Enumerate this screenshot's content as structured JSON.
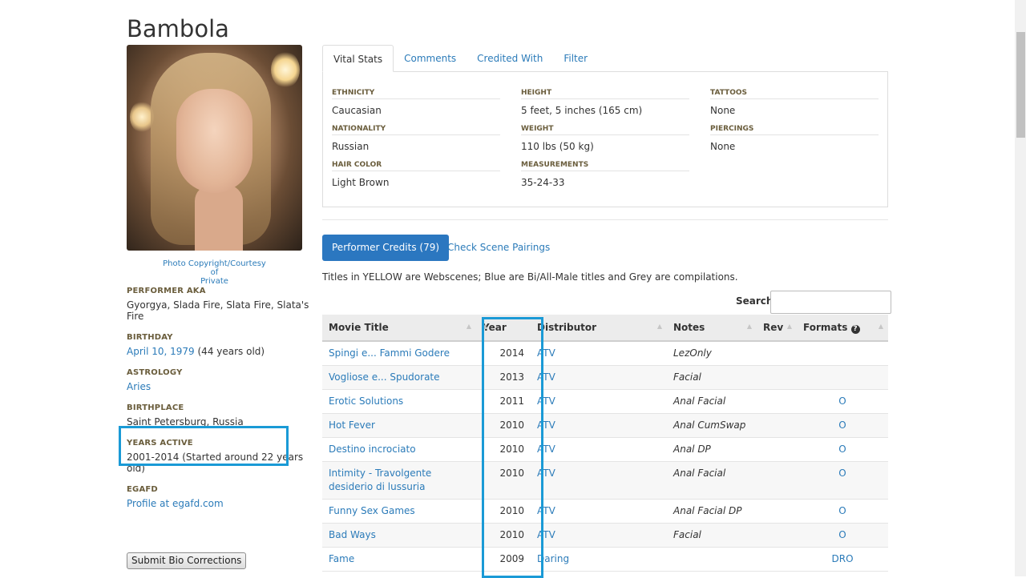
{
  "page": {
    "title": "Bambola"
  },
  "photo": {
    "credit_line1": "Photo Copyright/Courtesy of",
    "credit_line2": "Private"
  },
  "bio": {
    "aka_label": "PERFORMER AKA",
    "aka_value": "Gyorgya, Slada Fire, Slata Fire, Slata's Fire",
    "birthday_label": "BIRTHDAY",
    "birthday_link": "April 10, 1979",
    "birthday_age": " (44 years old)",
    "astrology_label": "ASTROLOGY",
    "astrology_value": "Aries",
    "birthplace_label": "BIRTHPLACE",
    "birthplace_value": "Saint Petersburg, Russia",
    "years_label": "YEARS ACTIVE",
    "years_value": "2001-2014 (Started around 22 years old)",
    "egafd_label": "EGAFD",
    "egafd_link": "Profile at egafd.com",
    "submit_label": "Submit Bio Corrections"
  },
  "tabs": [
    {
      "label": "Vital Stats"
    },
    {
      "label": "Comments"
    },
    {
      "label": "Credited With"
    },
    {
      "label": "Filter"
    }
  ],
  "stats": {
    "ethnicity_label": "ETHNICITY",
    "ethnicity": "Caucasian",
    "nationality_label": "NATIONALITY",
    "nationality": "Russian",
    "hair_label": "HAIR COLOR",
    "hair": "Light Brown",
    "height_label": "HEIGHT",
    "height": "5 feet, 5 inches (165 cm)",
    "weight_label": "WEIGHT",
    "weight": "110 lbs (50 kg)",
    "measurements_label": "MEASUREMENTS",
    "measurements": "35-24-33",
    "tattoos_label": "TATTOOS",
    "tattoos": "None",
    "piercings_label": "PIERCINGS",
    "piercings": "None"
  },
  "credits": {
    "button_label": "Performer Credits (79)",
    "pairings_link": "Check Scene Pairings",
    "legend": "Titles in YELLOW are Webscenes; Blue are Bi/All-Male titles and Grey are compilations.",
    "search_label": "Search:",
    "search_value": "",
    "columns": [
      "Movie Title",
      "Year",
      "Distributor",
      "Notes",
      "Rev",
      "Formats"
    ],
    "rows": [
      {
        "title": "Spingi e... Fammi Godere",
        "year": "2014",
        "distributor": "ATV",
        "notes": "LezOnly",
        "rev": "",
        "formats": ""
      },
      {
        "title": "Vogliose e... Spudorate",
        "year": "2013",
        "distributor": "ATV",
        "notes": "Facial",
        "rev": "",
        "formats": ""
      },
      {
        "title": "Erotic Solutions",
        "year": "2011",
        "distributor": "ATV",
        "notes": "Anal Facial",
        "rev": "",
        "formats": "O"
      },
      {
        "title": "Hot Fever",
        "year": "2010",
        "distributor": "ATV",
        "notes": "Anal CumSwap",
        "rev": "",
        "formats": "O"
      },
      {
        "title": "Destino incrociato",
        "year": "2010",
        "distributor": "ATV",
        "notes": "Anal DP",
        "rev": "",
        "formats": "O"
      },
      {
        "title": "Intimity - Travolgente desiderio di lussuria",
        "year": "2010",
        "distributor": "ATV",
        "notes": "Anal Facial",
        "rev": "",
        "formats": "O"
      },
      {
        "title": "Funny Sex Games",
        "year": "2010",
        "distributor": "ATV",
        "notes": "Anal Facial DP",
        "rev": "",
        "formats": "O"
      },
      {
        "title": "Bad Ways",
        "year": "2010",
        "distributor": "ATV",
        "notes": "Facial",
        "rev": "",
        "formats": "O"
      },
      {
        "title": "Fame",
        "year": "2009",
        "distributor": "Daring",
        "notes": "",
        "rev": "",
        "formats": "DRO"
      }
    ]
  },
  "colors": {
    "link": "#2b7bb9",
    "primary_button": "#2b77c0",
    "highlight_box": "#1a9ad6",
    "egafd_link": "#7b1f8a"
  },
  "icons": {
    "formats_help": "question-circle-icon",
    "sort": "sort-arrows-icon"
  }
}
